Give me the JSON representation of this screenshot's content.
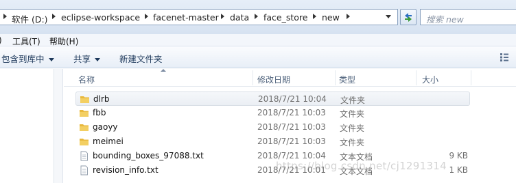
{
  "address_bar": {
    "path": [
      "软件 (D:)",
      "eclipse-workspace",
      "facenet-master",
      "data",
      "face_store",
      "new"
    ]
  },
  "search": {
    "placeholder": "搜索 new"
  },
  "menu": [
    {
      "label": "工具(T)"
    },
    {
      "label": "帮助(H)"
    }
  ],
  "toolbar": {
    "include_in_library": "包含到库中",
    "share": "共享",
    "new_folder": "新建文件夹"
  },
  "columns": {
    "name": "名称",
    "date_modified": "修改日期",
    "type": "类型",
    "size": "大小"
  },
  "files": [
    {
      "name": "dlrb",
      "date": "2018/7/21 10:04",
      "type": "文件夹",
      "size": "",
      "icon": "folder-icon",
      "selected": true
    },
    {
      "name": "fbb",
      "date": "2018/7/21 10:03",
      "type": "文件夹",
      "size": "",
      "icon": "folder-icon"
    },
    {
      "name": "gaoyy",
      "date": "2018/7/21 10:03",
      "type": "文件夹",
      "size": "",
      "icon": "folder-icon"
    },
    {
      "name": "meimei",
      "date": "2018/7/21 10:03",
      "type": "文件夹",
      "size": "",
      "icon": "folder-icon"
    },
    {
      "name": "bounding_boxes_97088.txt",
      "date": "2018/7/21 10:04",
      "type": "文本文档",
      "size": "9 KB",
      "icon": "text-file-icon"
    },
    {
      "name": "revision_info.txt",
      "date": "2018/7/21 10:01",
      "type": "文本文档",
      "size": "1 KB",
      "icon": "text-file-icon"
    }
  ],
  "watermark": "https://blog.csdn.net/cj1291314",
  "colors": {
    "folder": "#e8b83c",
    "selection": "#ebeff4",
    "toolbar_text": "#1e395b"
  }
}
